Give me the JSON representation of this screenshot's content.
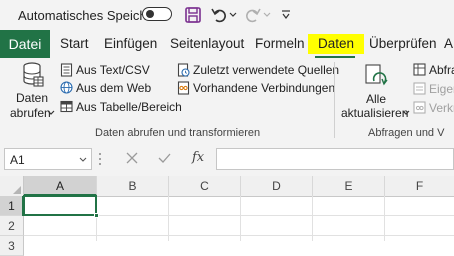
{
  "titlebar": {
    "autosave_label": "Automatisches Speichern",
    "autosave_state": "off"
  },
  "tabs": [
    {
      "label": "Datei"
    },
    {
      "label": "Start"
    },
    {
      "label": "Einfügen"
    },
    {
      "label": "Seitenlayout"
    },
    {
      "label": "Formeln"
    },
    {
      "label": "Daten"
    },
    {
      "label": "Überprüfen"
    },
    {
      "label": "A"
    }
  ],
  "ribbon": {
    "get_data": {
      "line1": "Daten",
      "line2": "abrufen"
    },
    "from_text_csv": "Aus Text/CSV",
    "from_web": "Aus dem Web",
    "from_table": "Aus Tabelle/Bereich",
    "recent_sources": "Zuletzt verwendete Quellen",
    "existing_connections": "Vorhandene Verbindungen",
    "group_get_transform": "Daten abrufen und transformieren",
    "refresh_all": {
      "line1": "Alle",
      "line2": "aktualisieren"
    },
    "queries_item": "Abfra",
    "properties_item": "Eigen",
    "edit_links_item": "Verkn",
    "group_queries": "Abfragen und V"
  },
  "formula_bar": {
    "name_box": "A1",
    "fx": "fx",
    "formula": ""
  },
  "grid": {
    "columns": [
      "A",
      "B",
      "C",
      "D",
      "E",
      "F"
    ],
    "rows": [
      "1",
      "2",
      "3"
    ],
    "selected_cell": "A1"
  },
  "colors": {
    "accent": "#217346",
    "highlight": "#ffff00",
    "ribbon_bg": "#f3f3f3"
  }
}
